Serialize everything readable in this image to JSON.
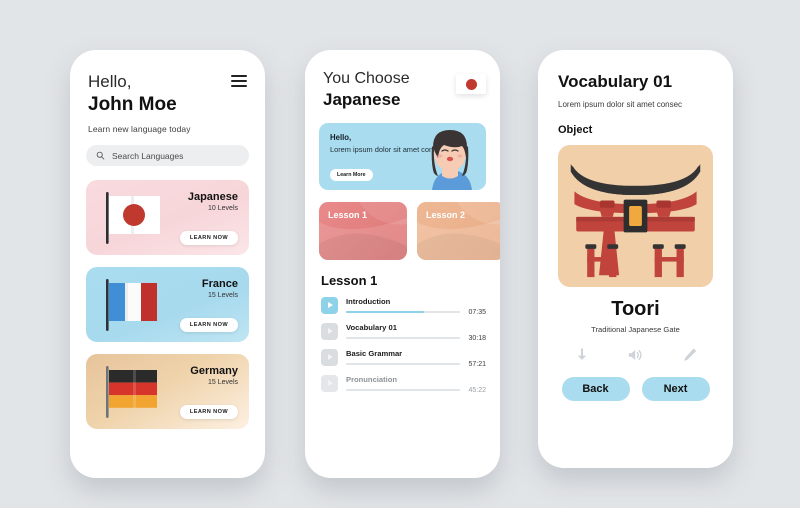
{
  "theme": {
    "background": "#e2e5e8",
    "phone_bg": "#ffffff",
    "accent_blue": "#a9dcee",
    "accent_red": "#c0392f",
    "track_active": "#8ed2ea"
  },
  "phone1": {
    "greeting_line1": "Hello,",
    "greeting_name": "John Moe",
    "subtitle": "Learn new language today",
    "menu_icon": "hamburger-icon",
    "search": {
      "icon": "search-icon",
      "placeholder": "Search Languages",
      "value": ""
    },
    "languages": [
      {
        "name": "Japanese",
        "levels": "10 Levels",
        "cta": "LEARN NOW",
        "flag": "japan-flag",
        "theme": "jp"
      },
      {
        "name": "France",
        "levels": "15 Levels",
        "cta": "LEARN NOW",
        "flag": "france-flag",
        "theme": "fr"
      },
      {
        "name": "Germany",
        "levels": "15 Levels",
        "cta": "LEARN NOW",
        "flag": "germany-flag",
        "theme": "de"
      }
    ]
  },
  "phone2": {
    "title_line1": "You Choose",
    "title_line2": "Japanese",
    "flag_badge": "japan-flag-badge",
    "promo": {
      "heading": "Hello,",
      "body": "Lorem ipsum dolor sit amet consec",
      "cta": "Learn More",
      "illustration": "woman-avatar"
    },
    "lesson_cards": [
      {
        "label": "Lesson 1",
        "theme": "lc1"
      },
      {
        "label": "Lesson 2",
        "theme": "lc2"
      }
    ],
    "lesson_heading": "Lesson 1",
    "tracks": [
      {
        "name": "Introduction",
        "time": "07:35",
        "progress": 68,
        "state": "active"
      },
      {
        "name": "Vocabulary 01",
        "time": "30:18",
        "progress": 0,
        "state": "idle"
      },
      {
        "name": "Basic Grammar",
        "time": "57:21",
        "progress": 0,
        "state": "idle"
      },
      {
        "name": "Pronunciation",
        "time": "45:22",
        "progress": 0,
        "state": "muted"
      }
    ]
  },
  "phone3": {
    "title": "Vocabulary 01",
    "subtitle": "Lorem ipsum dolor sit amet consec",
    "section_label": "Object",
    "illustration": "torii-gate",
    "word": "Toori",
    "word_meaning": "Traditional Japanese Gate",
    "actions": [
      {
        "icon": "download-icon"
      },
      {
        "icon": "speaker-icon"
      },
      {
        "icon": "pencil-icon"
      }
    ],
    "nav": {
      "back_label": "Back",
      "next_label": "Next"
    }
  }
}
